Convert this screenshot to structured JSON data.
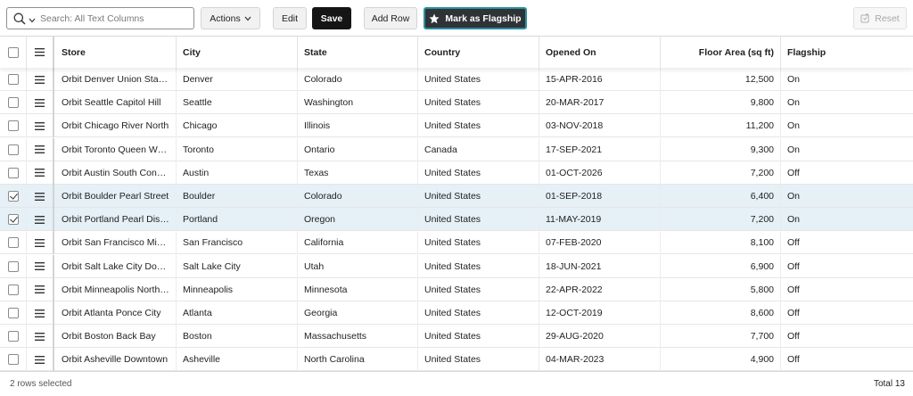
{
  "toolbar": {
    "search_placeholder": "Search: All Text Columns",
    "actions_label": "Actions",
    "edit_label": "Edit",
    "save_label": "Save",
    "add_row_label": "Add Row",
    "flagship_label": "Mark as Flagship",
    "reset_label": "Reset"
  },
  "grid": {
    "columns": [
      {
        "label": "Store"
      },
      {
        "label": "City"
      },
      {
        "label": "State"
      },
      {
        "label": "Country"
      },
      {
        "label": "Opened On"
      },
      {
        "label": "Floor Area (sq ft)"
      },
      {
        "label": "Flagship"
      }
    ],
    "rows": [
      {
        "selected": false,
        "store": "Orbit Denver Union Station",
        "city": "Denver",
        "state": "Colorado",
        "country": "United States",
        "opened": "15-APR-2016",
        "area": "12,500",
        "flagship": "On"
      },
      {
        "selected": false,
        "store": "Orbit Seattle Capitol Hill",
        "city": "Seattle",
        "state": "Washington",
        "country": "United States",
        "opened": "20-MAR-2017",
        "area": "9,800",
        "flagship": "On"
      },
      {
        "selected": false,
        "store": "Orbit Chicago River North",
        "city": "Chicago",
        "state": "Illinois",
        "country": "United States",
        "opened": "03-NOV-2018",
        "area": "11,200",
        "flagship": "On"
      },
      {
        "selected": false,
        "store": "Orbit Toronto Queen West",
        "city": "Toronto",
        "state": "Ontario",
        "country": "Canada",
        "opened": "17-SEP-2021",
        "area": "9,300",
        "flagship": "On"
      },
      {
        "selected": false,
        "store": "Orbit Austin South Congress",
        "city": "Austin",
        "state": "Texas",
        "country": "United States",
        "opened": "01-OCT-2026",
        "area": "7,200",
        "flagship": "Off"
      },
      {
        "selected": true,
        "store": "Orbit Boulder Pearl Street",
        "city": "Boulder",
        "state": "Colorado",
        "country": "United States",
        "opened": "01-SEP-2018",
        "area": "6,400",
        "flagship": "On"
      },
      {
        "selected": true,
        "store": "Orbit Portland Pearl District",
        "city": "Portland",
        "state": "Oregon",
        "country": "United States",
        "opened": "11-MAY-2019",
        "area": "7,200",
        "flagship": "On"
      },
      {
        "selected": false,
        "store": "Orbit San Francisco Mission",
        "city": "San Francisco",
        "state": "California",
        "country": "United States",
        "opened": "07-FEB-2020",
        "area": "8,100",
        "flagship": "Off"
      },
      {
        "selected": false,
        "store": "Orbit Salt Lake City Downtown",
        "city": "Salt Lake City",
        "state": "Utah",
        "country": "United States",
        "opened": "18-JUN-2021",
        "area": "6,900",
        "flagship": "Off"
      },
      {
        "selected": false,
        "store": "Orbit Minneapolis North Loop",
        "city": "Minneapolis",
        "state": "Minnesota",
        "country": "United States",
        "opened": "22-APR-2022",
        "area": "5,800",
        "flagship": "Off"
      },
      {
        "selected": false,
        "store": "Orbit Atlanta Ponce City",
        "city": "Atlanta",
        "state": "Georgia",
        "country": "United States",
        "opened": "12-OCT-2019",
        "area": "8,600",
        "flagship": "Off"
      },
      {
        "selected": false,
        "store": "Orbit Boston Back Bay",
        "city": "Boston",
        "state": "Massachusetts",
        "country": "United States",
        "opened": "29-AUG-2020",
        "area": "7,700",
        "flagship": "Off"
      },
      {
        "selected": false,
        "store": "Orbit Asheville Downtown",
        "city": "Asheville",
        "state": "North Carolina",
        "country": "United States",
        "opened": "04-MAR-2023",
        "area": "4,900",
        "flagship": "Off"
      }
    ]
  },
  "footer": {
    "selection_status": "2 rows selected",
    "total_label": "Total 13"
  }
}
